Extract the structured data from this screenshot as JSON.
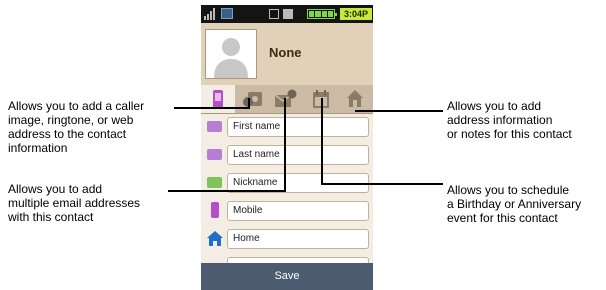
{
  "status_bar": {
    "time": "3:04P",
    "icons": [
      "signal-icon",
      "message-icon",
      "sd-card-icon",
      "lock-icon",
      "battery-icon"
    ]
  },
  "contact": {
    "name": "None",
    "photo_icon": "person-silhouette-icon"
  },
  "tabs": [
    {
      "name": "phone-numbers",
      "icon": "phone-icon",
      "active": true
    },
    {
      "name": "caller-image-ringtone-web",
      "icon": "camera-ringtone-icon",
      "active": false
    },
    {
      "name": "email-addresses",
      "icon": "email-icon",
      "active": false
    },
    {
      "name": "events",
      "icon": "calendar-icon",
      "active": false
    },
    {
      "name": "address-notes",
      "icon": "home-icon",
      "active": false
    }
  ],
  "fields": [
    {
      "icon": "name-card-icon",
      "placeholder": "First name"
    },
    {
      "icon": "name-card-icon",
      "placeholder": "Last name"
    },
    {
      "icon": "nickname-card-icon",
      "placeholder": "Nickname"
    },
    {
      "icon": "mobile-phone-icon",
      "placeholder": "Mobile"
    },
    {
      "icon": "home-icon",
      "placeholder": "Home"
    }
  ],
  "save_label": "Save",
  "callouts": {
    "caller_image": [
      "Allows you to add a caller",
      "image, ringtone, or web",
      "address to the contact",
      "information"
    ],
    "email": [
      "Allows you to add",
      "multiple email addresses",
      "with this contact"
    ],
    "address": [
      "Allows you to add",
      "address information",
      "or notes for this contact"
    ],
    "events": [
      "Allows you to schedule",
      "a Birthday or Anniversary",
      "event for this contact"
    ]
  },
  "colors": {
    "accent_tab": "#b54fc8",
    "save_bar": "#4c5b70",
    "status_time_bg": "#c8e83a",
    "home_icon": "#1f6fc9"
  }
}
